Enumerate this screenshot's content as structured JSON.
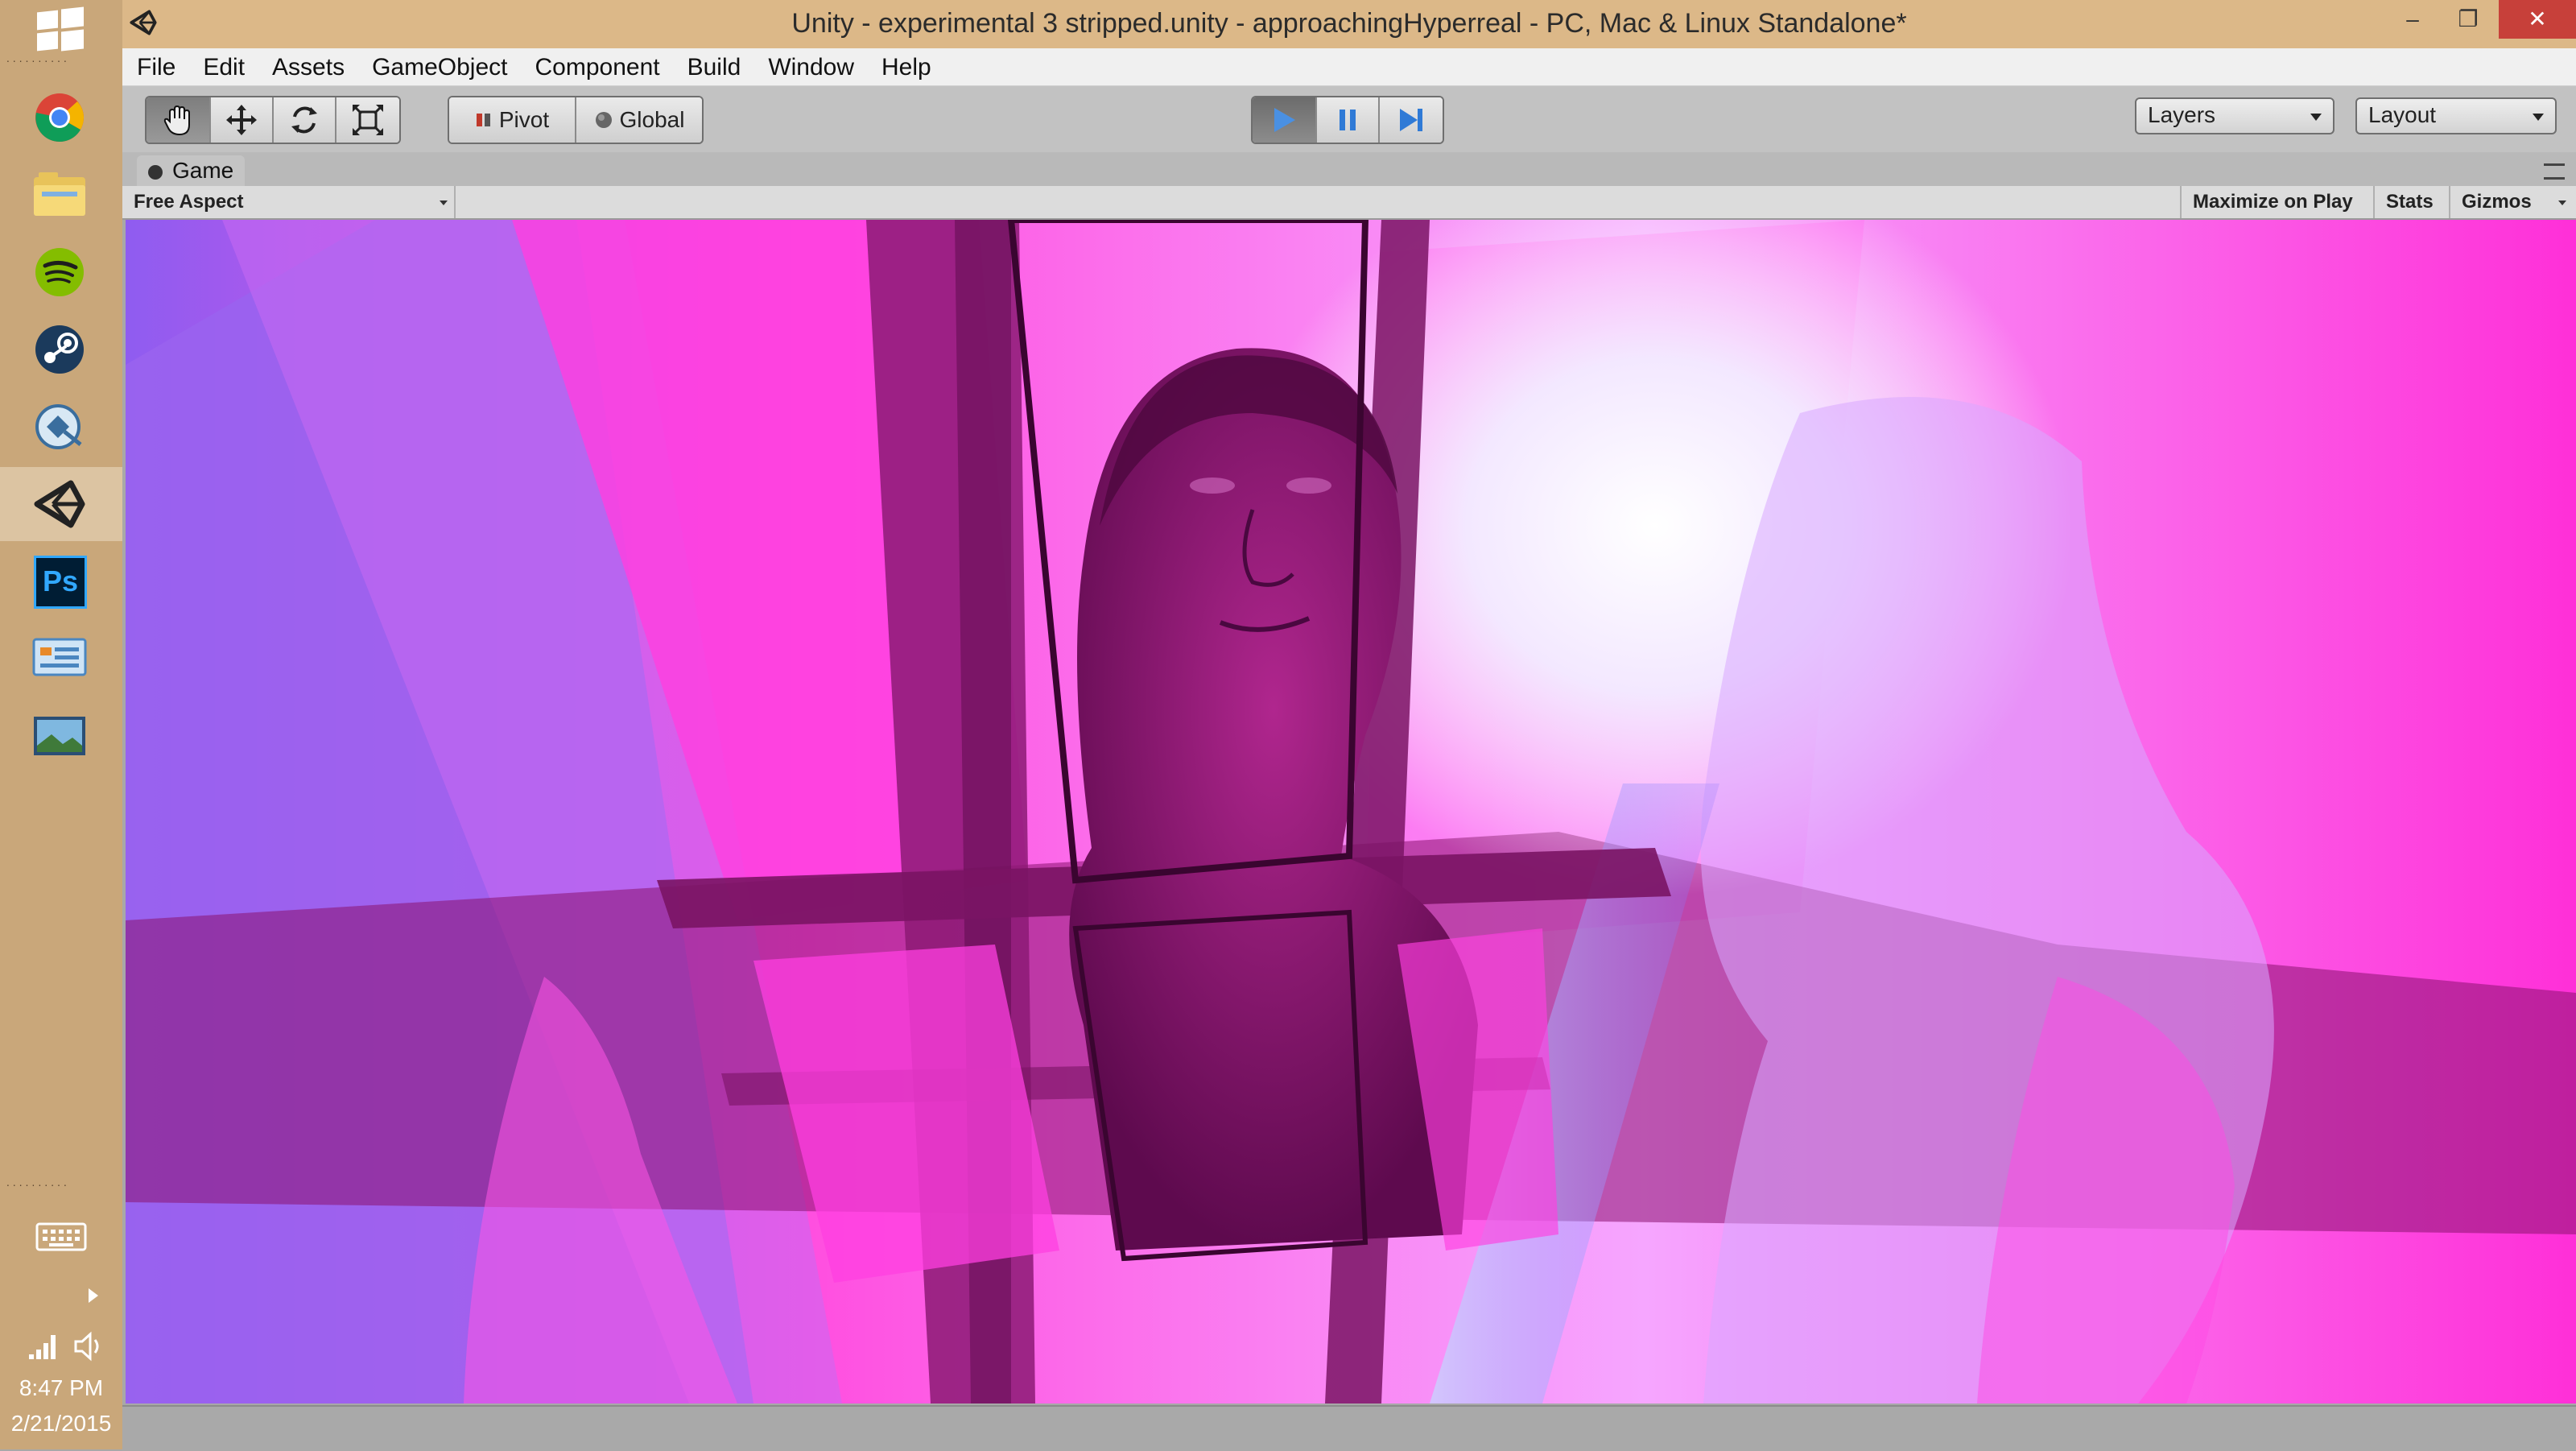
{
  "window": {
    "title": "Unity - experimental 3 stripped.unity - approachingHyperreal - PC, Mac & Linux Standalone*",
    "controls": {
      "minimize": "–",
      "restore": "❐",
      "close": "✕"
    }
  },
  "menu": [
    "File",
    "Edit",
    "Assets",
    "GameObject",
    "Component",
    "Build",
    "Window",
    "Help"
  ],
  "toolbar": {
    "tools": [
      "hand-icon",
      "move-icon",
      "rotate-icon",
      "scale-icon"
    ],
    "pivot_label": "Pivot",
    "global_label": "Global",
    "playback": [
      "play-icon",
      "pause-icon",
      "step-icon"
    ],
    "play_active": true,
    "layers_label": "Layers",
    "layout_label": "Layout"
  },
  "game_panel": {
    "tab_label": "Game",
    "aspect_label": "Free Aspect",
    "maximize_label": "Maximize on Play",
    "stats_label": "Stats",
    "gizmos_label": "Gizmos"
  },
  "taskbar": {
    "apps": [
      "chrome-icon",
      "file-explorer-icon",
      "spotify-icon",
      "steam-icon",
      "remote-desktop-icon",
      "unity-icon",
      "photoshop-icon",
      "control-panel-icon",
      "photo-viewer-icon"
    ],
    "active_app": "unity-icon",
    "photoshop_text": "Ps",
    "time": "8:47 PM",
    "date": "2/21/2015"
  },
  "colors": {
    "taskbar": "#c9a77a",
    "titlebar": "#dcb888",
    "close_button": "#c7403a",
    "play_active": "#4a90e2",
    "scene_magenta": "#ff2fd8",
    "scene_violet": "#8a4fe8",
    "scene_dark": "#8a1270"
  }
}
